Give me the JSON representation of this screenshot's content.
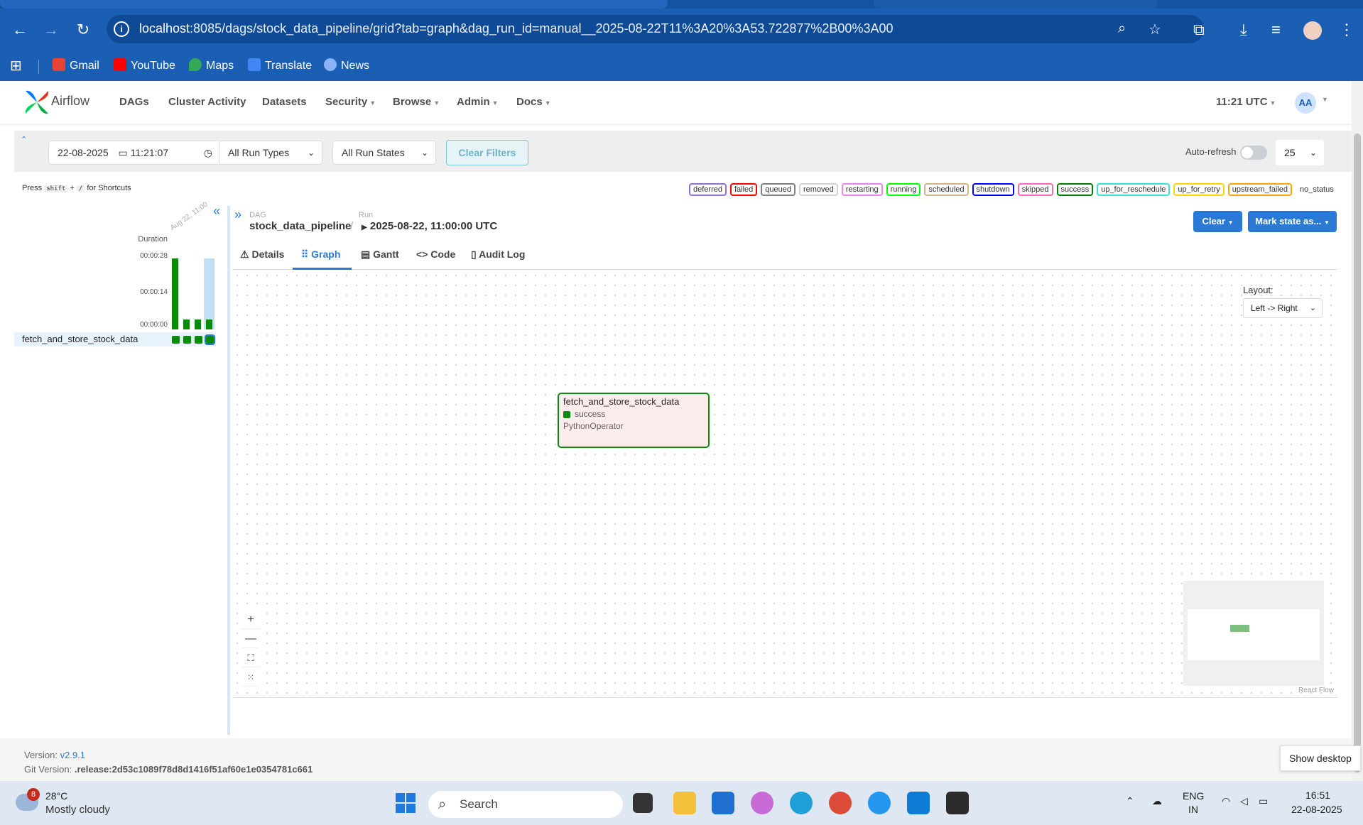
{
  "browser": {
    "url_host": "localhost",
    "url_rest": ":8085/dags/stock_data_pipeline/grid?tab=graph&dag_run_id=manual__2025-08-22T11%3A20%3A53.722877%2B00%3A00",
    "bookmarks": [
      {
        "label": "Gmail",
        "icon": "gmail-icon",
        "color": "#ea4335"
      },
      {
        "label": "YouTube",
        "icon": "youtube-icon",
        "color": "#ff0000"
      },
      {
        "label": "Maps",
        "icon": "maps-icon",
        "color": "#34a853"
      },
      {
        "label": "Translate",
        "icon": "translate-icon",
        "color": "#4285f4"
      },
      {
        "label": "News",
        "icon": "news-icon",
        "color": "#8ab4f8"
      }
    ]
  },
  "header": {
    "brand": "Airflow",
    "menu": [
      {
        "label": "DAGs",
        "dropdown": false
      },
      {
        "label": "Cluster Activity",
        "dropdown": false
      },
      {
        "label": "Datasets",
        "dropdown": false
      },
      {
        "label": "Security",
        "dropdown": true
      },
      {
        "label": "Browse",
        "dropdown": true
      },
      {
        "label": "Admin",
        "dropdown": true
      },
      {
        "label": "Docs",
        "dropdown": true
      }
    ],
    "clock": "11:21 UTC",
    "avatar": "AA"
  },
  "filters": {
    "date": "22-08-2025",
    "time": "11:21:07",
    "run_types": "All Run Types",
    "run_states": "All Run States",
    "clear_filters": "Clear Filters",
    "auto_refresh": "Auto-refresh",
    "num_runs": "25"
  },
  "shortcuts": {
    "press": "Press",
    "key1": "shift",
    "plus": "+",
    "key2": "/",
    "suffix": "for Shortcuts"
  },
  "legend": [
    {
      "label": "deferred",
      "color": "#9370db"
    },
    {
      "label": "failed",
      "color": "#ff0000"
    },
    {
      "label": "queued",
      "color": "#808080"
    },
    {
      "label": "removed",
      "color": "#d3d3d3"
    },
    {
      "label": "restarting",
      "color": "#ee82ee"
    },
    {
      "label": "running",
      "color": "#00ff00"
    },
    {
      "label": "scheduled",
      "color": "#d2b48c"
    },
    {
      "label": "shutdown",
      "color": "#0000ff"
    },
    {
      "label": "skipped",
      "color": "#ff69b4"
    },
    {
      "label": "success",
      "color": "#008000"
    },
    {
      "label": "up_for_reschedule",
      "color": "#40e0d0"
    },
    {
      "label": "up_for_retry",
      "color": "#ffd700"
    },
    {
      "label": "upstream_failed",
      "color": "#ffa500"
    },
    {
      "label": "no_status",
      "color": "#ffffff"
    }
  ],
  "grid": {
    "duration_label": "Duration",
    "date_label": "Aug 22, 11:00",
    "ticks": [
      "00:00:28",
      "00:00:14",
      "00:00:00"
    ],
    "task": "fetch_and_store_stock_data"
  },
  "details": {
    "dag_label": "DAG",
    "run_label": "Run",
    "dag_id": "stock_data_pipeline",
    "run_id": "2025-08-22, 11:00:00 UTC",
    "clear": "Clear",
    "mark_state": "Mark state as...",
    "tabs": [
      "Details",
      "Graph",
      "Gantt",
      "Code",
      "Audit Log"
    ],
    "active_tab": "Graph"
  },
  "graph": {
    "layout_label": "Layout:",
    "layout_value": "Left -> Right",
    "node": {
      "name": "fetch_and_store_stock_data",
      "state": "success",
      "operator": "PythonOperator"
    },
    "attribution": "React Flow"
  },
  "footer": {
    "version_label": "Version:",
    "version": "v2.9.1",
    "git_label": "Git Version:",
    "git": ".release:2d53c1089f78d8d1416f51af60e1e0354781c661",
    "show_desktop": "Show desktop"
  },
  "taskbar": {
    "weather_badge": "8",
    "temp": "28°C",
    "weather": "Mostly cloudy",
    "search": "Search",
    "lang1": "ENG",
    "lang2": "IN",
    "time": "16:51",
    "date": "22-08-2025"
  }
}
